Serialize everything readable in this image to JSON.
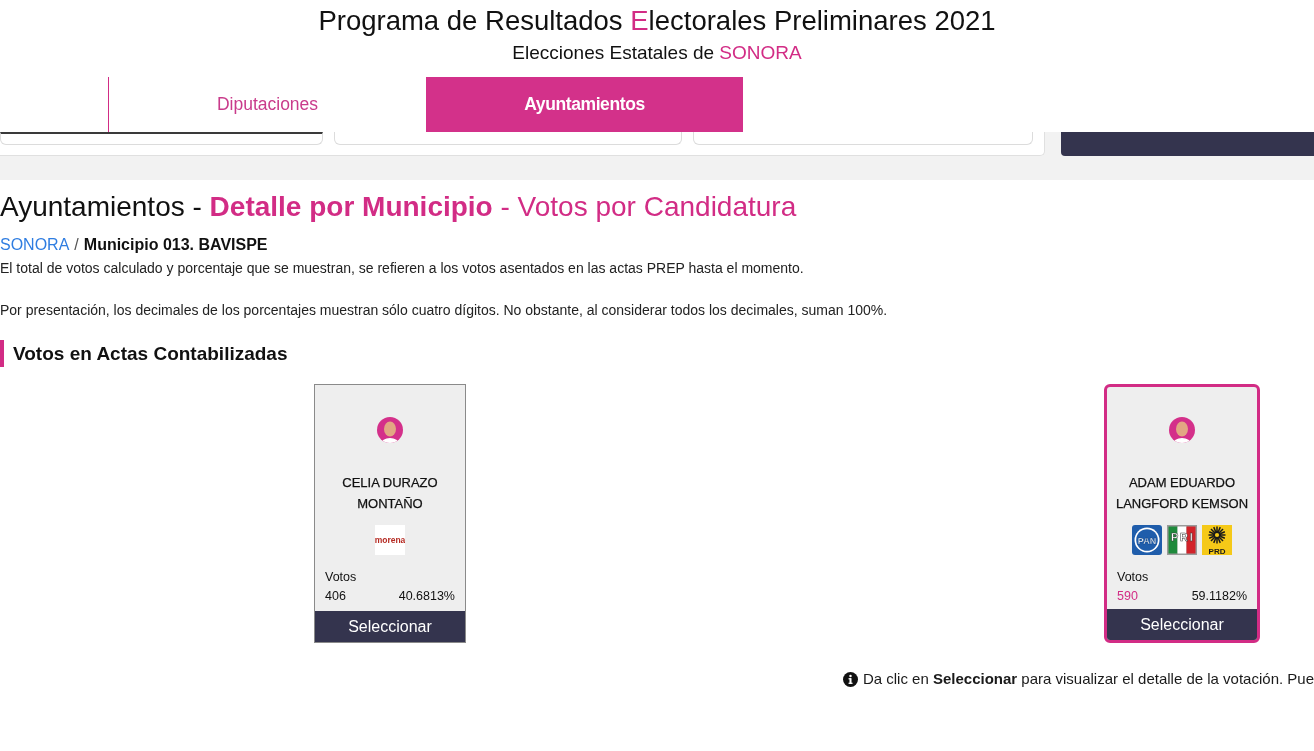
{
  "header": {
    "title": {
      "lead": "Programa de Resultados ",
      "accent": "E",
      "rest": "lectorales Preliminares 2021"
    },
    "subtitle": {
      "lead": "Elecciones Estatales de ",
      "accent": "SONORA"
    }
  },
  "tabs": [
    {
      "label": "Diputaciones",
      "selected": false
    },
    {
      "label": "Ayuntamientos",
      "selected": true
    }
  ],
  "page_heading": {
    "lead": "Ayuntamientos - ",
    "accent": "**Detalle por Municipio** - Votos por Candidatura"
  },
  "breadcrumb": {
    "items": [
      {
        "label": "SONORA",
        "kind": "link"
      },
      {
        "label": "Municipio 013. BAVISPE",
        "kind": "current"
      }
    ],
    "separator": "/"
  },
  "notes": [
    "El total de votos calculado y porcentaje que se muestran, se refieren a los votos asentados en las actas PREP hasta el momento.",
    "Por presentación, los decimales de los porcentajes muestran sólo cuatro dígitos. No obstante, al considerar todos los decimales, suman 100%."
  ],
  "section": {
    "title": "Votos en Actas Contabilizadas"
  },
  "candidates": [
    {
      "name": "CELIA DURAZO MONTAÑO",
      "parties": [
        {
          "kind": "morena",
          "label": "morena"
        }
      ],
      "votes_label": "Votos",
      "votes": "406",
      "percent": "40.6813%",
      "button": "Seleccionar",
      "leading": false
    },
    {
      "name": "ADAM EDUARDO LANGFORD KEMSON",
      "parties": [
        {
          "kind": "pan",
          "label": "PAN"
        },
        {
          "kind": "pri",
          "label": "PRI"
        },
        {
          "kind": "prd",
          "label": "PRD"
        }
      ],
      "votes_label": "Votos",
      "votes": "590",
      "percent": "59.1182%",
      "button": "Seleccionar",
      "leading": true
    }
  ],
  "hint": "Da clic en **Seleccionar** para visualizar el detalle de la votación. Pue"
}
